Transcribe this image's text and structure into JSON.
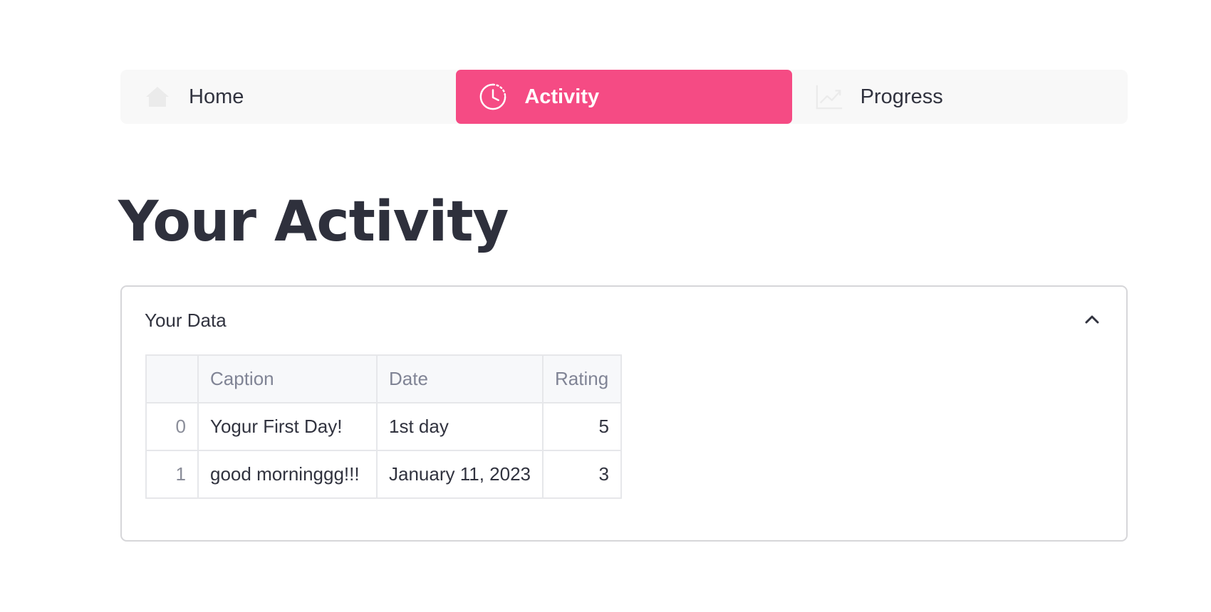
{
  "nav": {
    "items": [
      {
        "label": "Home",
        "icon": "home-icon"
      },
      {
        "label": "Activity",
        "icon": "clock-icon",
        "active": true
      },
      {
        "label": "Progress",
        "icon": "chart-line-icon"
      }
    ],
    "active_color": "#f54b84"
  },
  "page": {
    "title": "Your Activity"
  },
  "expander": {
    "label": "Your Data",
    "expanded": true,
    "table": {
      "columns": [
        "",
        "Caption",
        "Date",
        "Rating"
      ],
      "rows": [
        {
          "index": "0",
          "caption": "Yogur First Day!",
          "date": "1st day",
          "rating": "5"
        },
        {
          "index": "1",
          "caption": "good morninggg!!!",
          "date": "January 11, 2023",
          "rating": "3"
        }
      ]
    }
  }
}
